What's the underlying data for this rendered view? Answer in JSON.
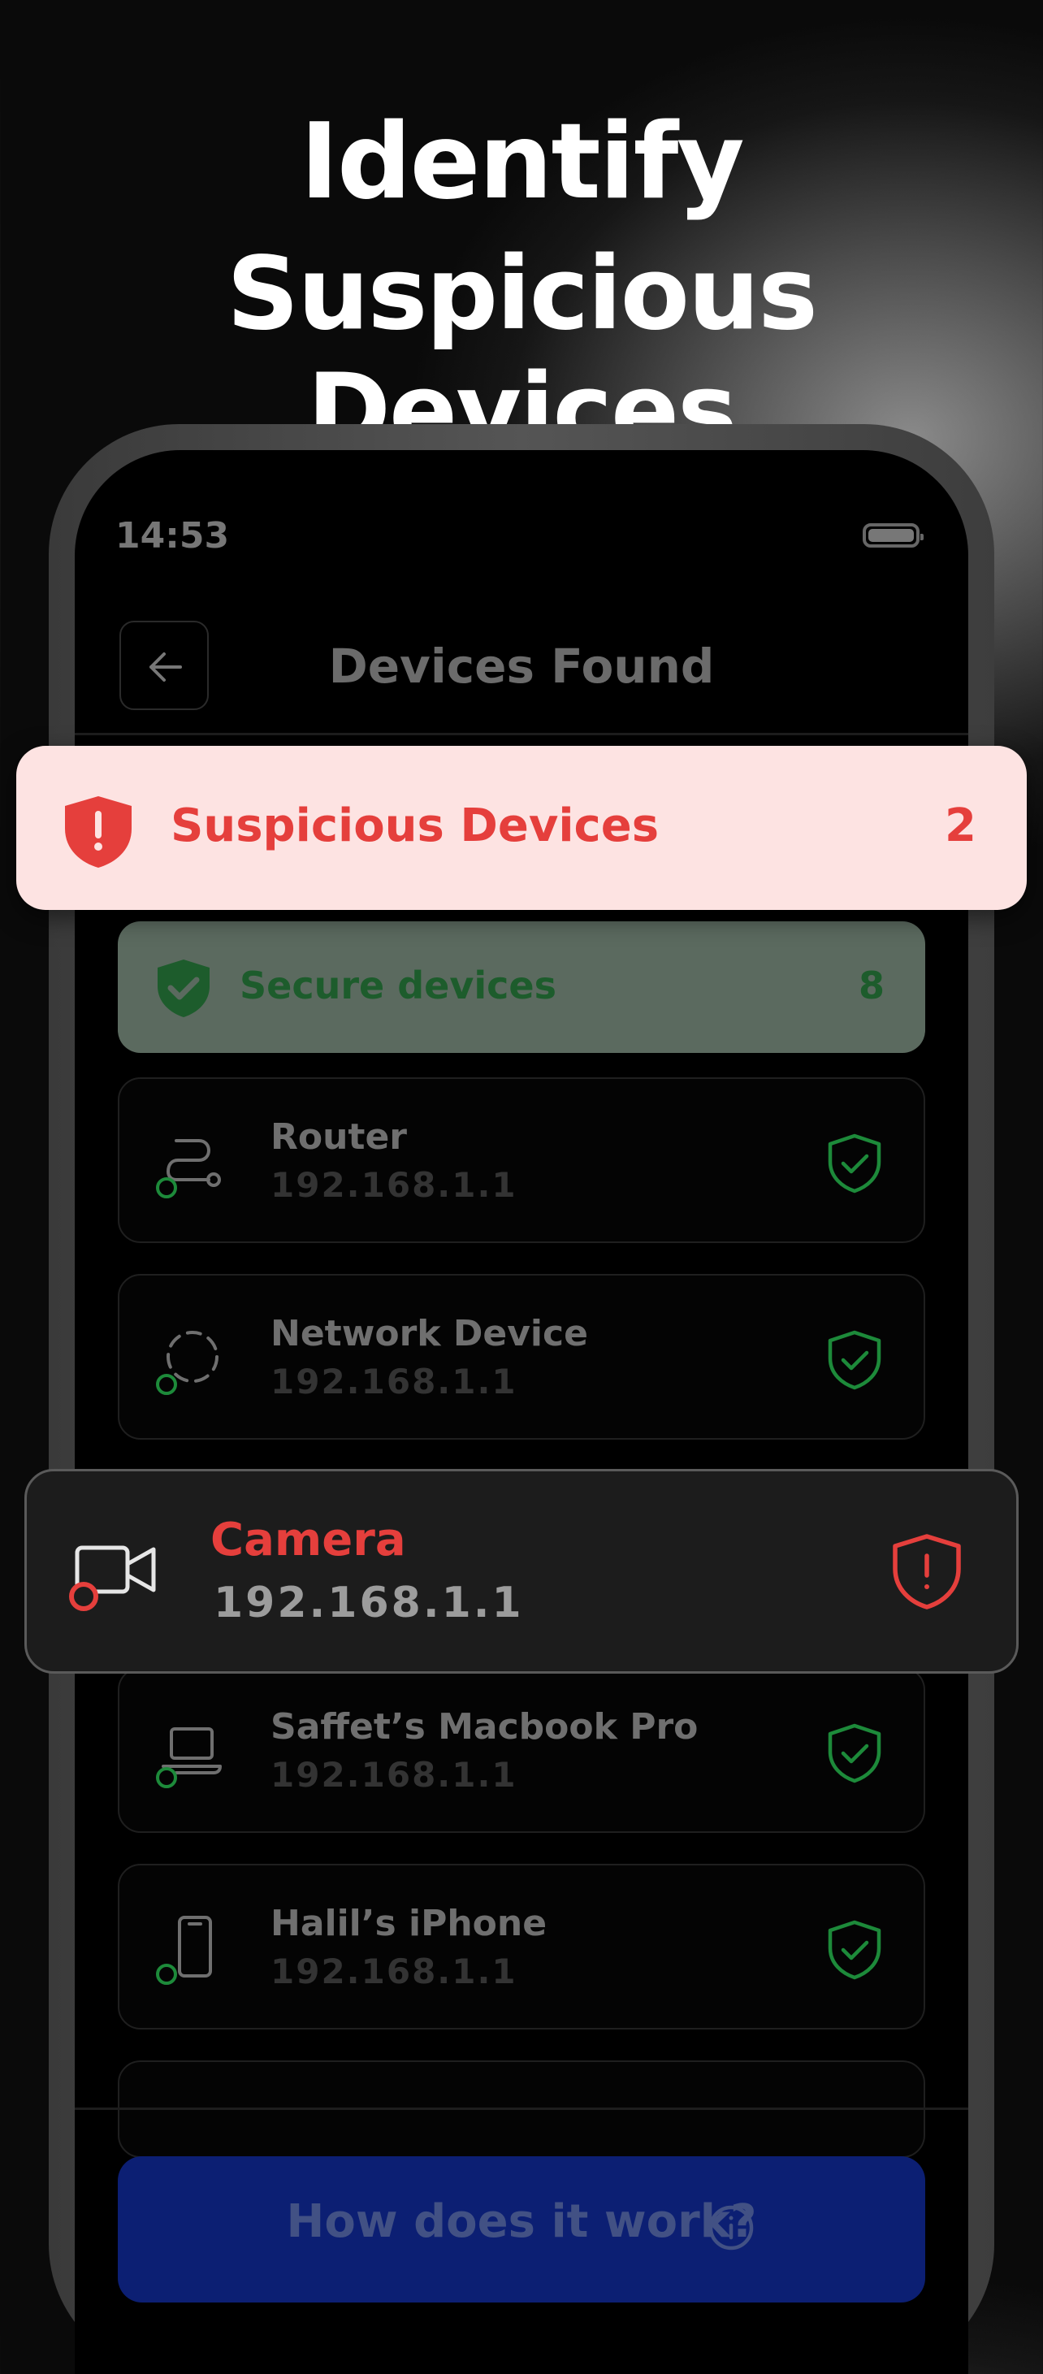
{
  "headline": {
    "line1": "Identify",
    "line2": "Suspicious Devices"
  },
  "status_bar": {
    "time": "14:53"
  },
  "nav": {
    "title": "Devices Found",
    "back_icon": "arrow-left-icon"
  },
  "suspicious_banner": {
    "label": "Suspicious Devices",
    "count": "2",
    "icon": "shield-alert-icon",
    "color": "#e53f3c",
    "background": "#fde3e2"
  },
  "secure_summary": {
    "label": "Secure devices",
    "count": "8",
    "icon": "shield-check-icon",
    "color": "#1d5c2c"
  },
  "devices": [
    {
      "name": "Router",
      "ip": "192.168.1.1",
      "icon": "router-icon",
      "status": "secure"
    },
    {
      "name": "Network Device",
      "ip": "192.168.1.1",
      "icon": "network-device-icon",
      "status": "secure"
    },
    {
      "name": "Camera",
      "ip": "192.168.1.1",
      "icon": "camera-icon",
      "status": "suspicious"
    },
    {
      "name": "Saffet’s Macbook Pro",
      "ip": "192.168.1.1",
      "icon": "laptop-icon",
      "status": "secure"
    },
    {
      "name": "Halil’s iPhone",
      "ip": "192.168.1.1",
      "icon": "phone-icon",
      "status": "secure"
    }
  ],
  "footer": {
    "button_label": "How does it work?",
    "icon": "info-icon"
  }
}
